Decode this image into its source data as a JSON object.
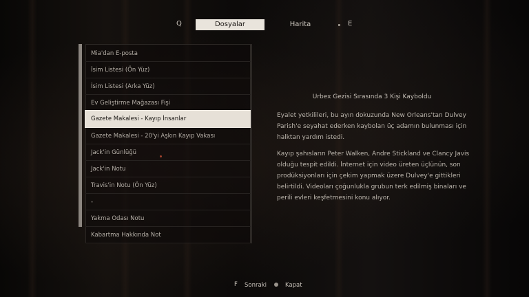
{
  "tabs": {
    "prev_key": "Q",
    "next_key": "E",
    "items": [
      {
        "label": "Dosyalar",
        "active": true
      },
      {
        "label": "Harita",
        "active": false
      }
    ]
  },
  "files": {
    "items": [
      {
        "label": "Mia'dan E-posta"
      },
      {
        "label": "İsim Listesi (Ön Yüz)"
      },
      {
        "label": "İsim Listesi (Arka Yüz)"
      },
      {
        "label": "Ev Geliştirme Mağazası Fişi"
      },
      {
        "label": "Gazete Makalesi - Kayıp İnsanlar",
        "selected": true
      },
      {
        "label": "Gazete Makalesi - 20'yi Aşkın Kayıp Vakası"
      },
      {
        "label": "Jack'in Günlüğü"
      },
      {
        "label": "Jack'in Notu"
      },
      {
        "label": "Travis'in Notu (Ön Yüz)"
      },
      {
        "label": "-"
      },
      {
        "label": "Yakma Odası Notu"
      },
      {
        "label": "Kabartma Hakkında Not"
      }
    ]
  },
  "document": {
    "title": "Urbex Gezisi Sırasında 3 Kişi Kayboldu",
    "paragraphs": [
      "Eyalet yetkilileri, bu ayın dokuzunda New Orleans'tan Dulvey Parish'e seyahat ederken kaybolan üç adamın bulunması için halktan yardım istedi.",
      "Kayıp şahısların Peter Walken, Andre Stickland ve Clancy Javis olduğu tespit edildi. İnternet için video üreten üçlünün, son prodüksiyonları için çekim yapmak üzere Dulvey'e gittikleri belirtildi. Videoları çoğunlukla grubun terk edilmiş binaları ve perili evleri keşfetmesini konu alıyor."
    ]
  },
  "hints": {
    "next_key": "F",
    "next_label": "Sonraki",
    "close_label": "Kapat"
  },
  "colors": {
    "background": "#0b0908",
    "selected_bg": "#e6e0d7",
    "text": "#b9b3ab"
  }
}
